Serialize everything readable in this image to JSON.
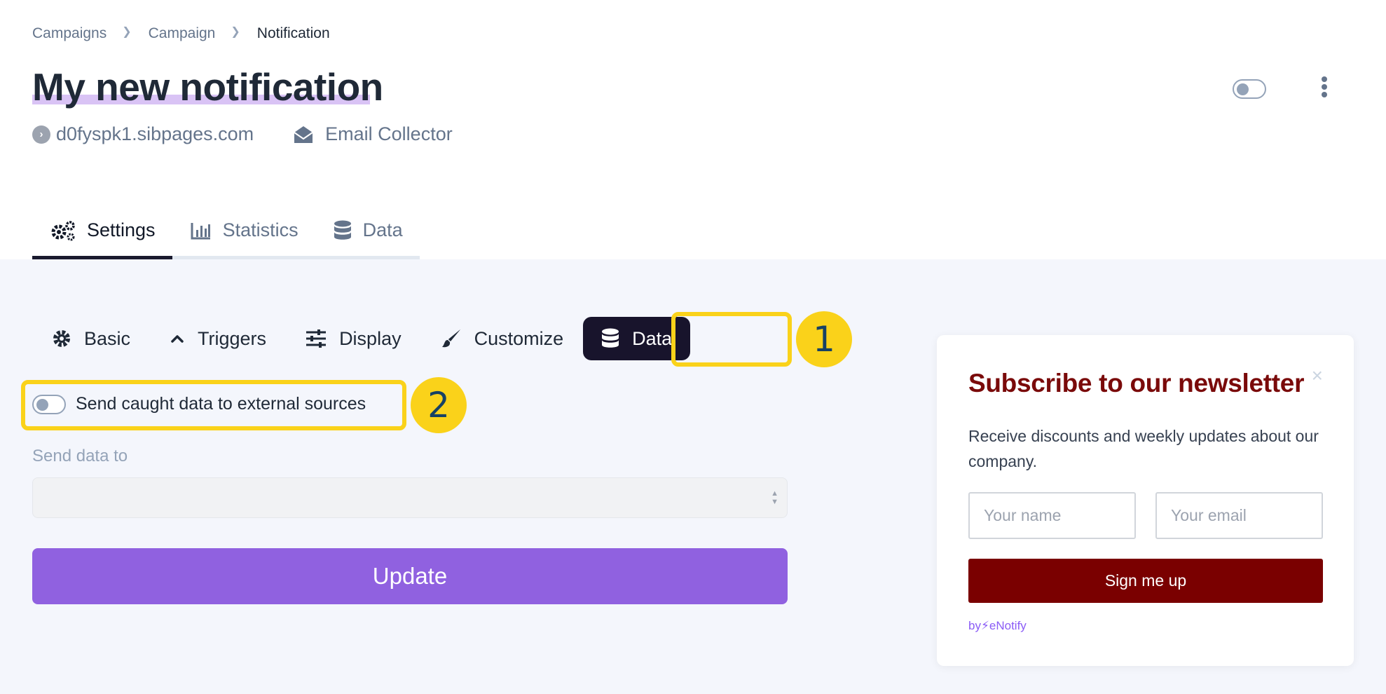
{
  "breadcrumb": {
    "items": [
      "Campaigns",
      "Campaign",
      "Notification"
    ]
  },
  "header": {
    "title": "My new notification",
    "domain": "d0fyspk1.sibpages.com",
    "type": "Email Collector",
    "toggle_on": false
  },
  "main_tabs": [
    {
      "label": "Settings",
      "icon": "gears-icon",
      "active": true
    },
    {
      "label": "Statistics",
      "icon": "bar-chart-icon",
      "active": false
    },
    {
      "label": "Data",
      "icon": "database-icon",
      "active": false
    }
  ],
  "sub_tabs": [
    {
      "label": "Basic",
      "icon": "gear-icon",
      "active": false
    },
    {
      "label": "Triggers",
      "icon": "chevron-up-icon",
      "active": false
    },
    {
      "label": "Display",
      "icon": "sliders-icon",
      "active": false
    },
    {
      "label": "Customize",
      "icon": "paint-brush-icon",
      "active": false
    },
    {
      "label": "Data",
      "icon": "database-icon",
      "active": true
    }
  ],
  "annotations": {
    "badge1": "1",
    "badge2": "2",
    "color": "#fad21a"
  },
  "form": {
    "send_toggle_label": "Send caught data to external sources",
    "send_toggle_on": false,
    "send_to_label": "Send data to",
    "send_to_value": "",
    "update_label": "Update"
  },
  "preview": {
    "title": "Subscribe to our newsletter",
    "text": "Receive discounts and weekly updates about our company.",
    "name_placeholder": "Your name",
    "email_placeholder": "Your email",
    "button_label": "Sign me up",
    "footer": "by⚡eNotify",
    "close": "×",
    "accent_color": "#7a0000"
  },
  "colors": {
    "primary": "#9061e0",
    "dark": "#18142c",
    "background": "#f4f6fc"
  }
}
